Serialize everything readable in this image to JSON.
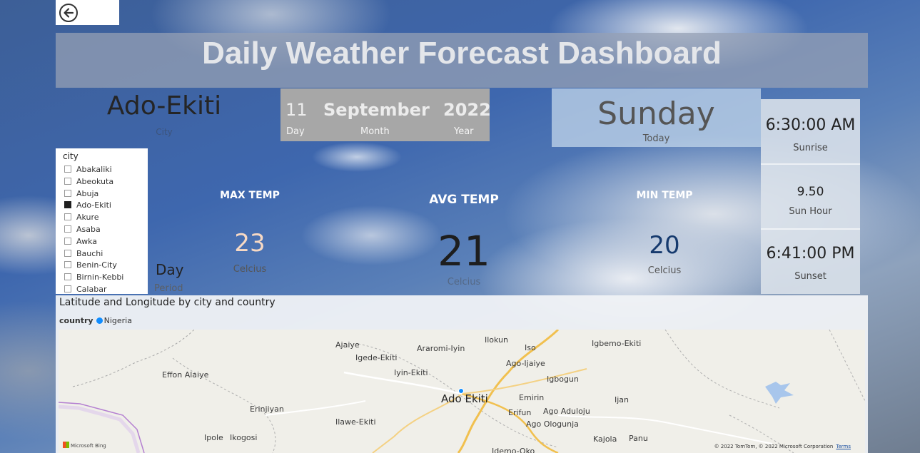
{
  "header": {
    "title": "Daily Weather Forecast Dashboard"
  },
  "city_card": {
    "value": "Ado-Ekiti",
    "label": "City"
  },
  "date": {
    "day": "11",
    "day_label": "Day",
    "month": "September",
    "month_label": "Month",
    "year": "2022",
    "year_label": "Year"
  },
  "today": {
    "value": "Sunday",
    "label": "Today"
  },
  "sun": {
    "sunrise": "6:30:00 AM",
    "sunrise_label": "Sunrise",
    "sun_hour": "9.50",
    "sun_hour_label": "Sun Hour",
    "sunset": "6:41:00 PM",
    "sunset_label": "Sunset"
  },
  "slicer": {
    "header": "city",
    "items": [
      {
        "label": "Abakaliki",
        "checked": false
      },
      {
        "label": "Abeokuta",
        "checked": false
      },
      {
        "label": "Abuja",
        "checked": false
      },
      {
        "label": "Ado-Ekiti",
        "checked": true
      },
      {
        "label": "Akure",
        "checked": false
      },
      {
        "label": "Asaba",
        "checked": false
      },
      {
        "label": "Awka",
        "checked": false
      },
      {
        "label": "Bauchi",
        "checked": false
      },
      {
        "label": "Benin-City",
        "checked": false
      },
      {
        "label": "Birnin-Kebbi",
        "checked": false
      },
      {
        "label": "Calabar",
        "checked": false
      }
    ]
  },
  "period": {
    "value": "Day",
    "label": "Period"
  },
  "metrics": {
    "max": {
      "title": "MAX TEMP",
      "value": "23",
      "unit": "Celcius",
      "color": "#f7d9c4"
    },
    "avg": {
      "title": "AVG TEMP",
      "value": "21",
      "unit": "Celcius",
      "color": "#1e1e1e"
    },
    "min": {
      "title": "MIN TEMP",
      "value": "20",
      "unit": "Celcius",
      "color": "#163a6e"
    }
  },
  "map": {
    "title": "Latitude and Longitude by city and country",
    "legend_label": "country",
    "legend_item": "Nigeria",
    "legend_color": "#118dff",
    "labels": {
      "ajaiye": "Ajaiye",
      "araromi": "Araromi-Iyin",
      "ilokun": "Ilokun",
      "iso": "Iso",
      "igbemo": "Igbemo-Ekiti",
      "igede": "Igede-Ekiti",
      "iyin": "Iyin-Ekiti",
      "effon": "Effon Alaiye",
      "ago_ijaiye": "Ago-Ijaiye",
      "igbogun": "Igbogun",
      "ado": "Ado Ekiti",
      "emirin": "Emirin",
      "ijan": "Ijan",
      "erinjiyan": "Erinjiyan",
      "erifun": "Erifun",
      "ago_aduloju": "Ago Aduloju",
      "ilawe": "Ilawe-Ekiti",
      "ago_ologunja": "Ago Ologunja",
      "ipole": "Ipole",
      "ikogosi": "Ikogosi",
      "kajola": "Kajola",
      "panu": "Panu",
      "idemo": "Idemo-Oko"
    },
    "bing": "Microsoft Bing",
    "attribution": "© 2022 TomTom, © 2022 Microsoft Corporation",
    "terms": "Terms"
  }
}
